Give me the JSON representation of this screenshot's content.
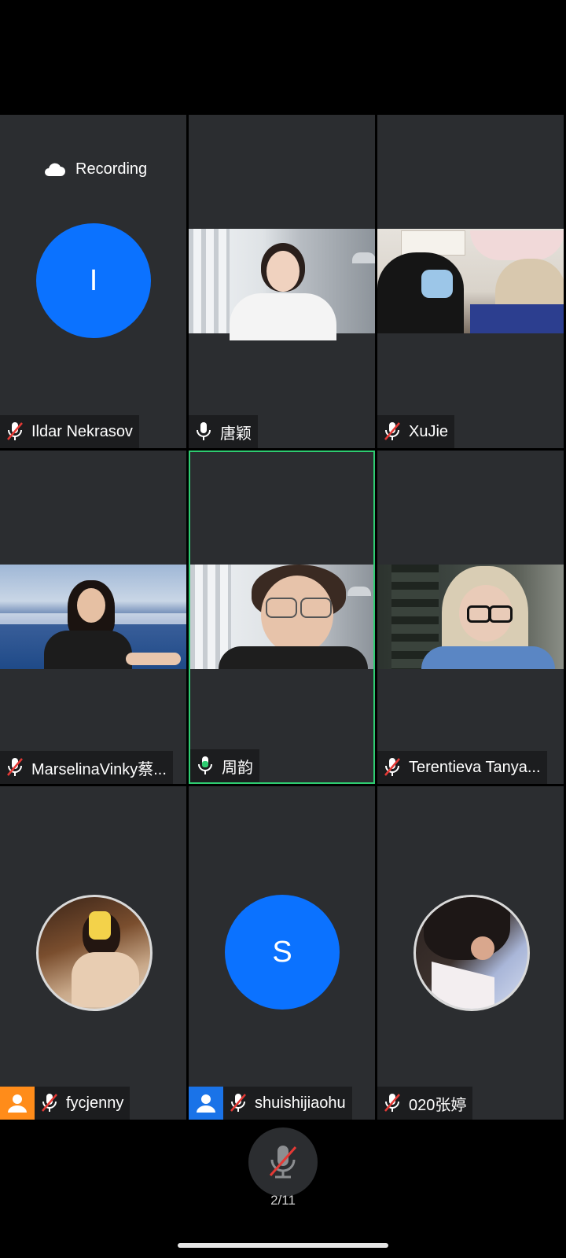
{
  "recording_label": "Recording",
  "tiles": [
    {
      "name": "Ildar Nekrasov",
      "initial": "I",
      "muted": true
    },
    {
      "name": "唐颖",
      "muted": false
    },
    {
      "name": "XuJie",
      "muted": true
    },
    {
      "name": "MarselinaVinky蔡...",
      "muted": true
    },
    {
      "name": "周韵",
      "muted": false,
      "speaking": true
    },
    {
      "name": "Terentieva Tanya...",
      "muted": true
    },
    {
      "name": "fycjenny",
      "muted": true
    },
    {
      "name": "shuishijiaohu",
      "initial": "S",
      "muted": true
    },
    {
      "name": "020张婷",
      "muted": true
    }
  ],
  "page_indicator": "2/11",
  "colors": {
    "avatar_blue": "#0b72ff",
    "speaking_green": "#2ecc71",
    "mute_red": "#e53935",
    "badge_orange": "#ff8c1a",
    "badge_blue": "#1a73e8"
  }
}
